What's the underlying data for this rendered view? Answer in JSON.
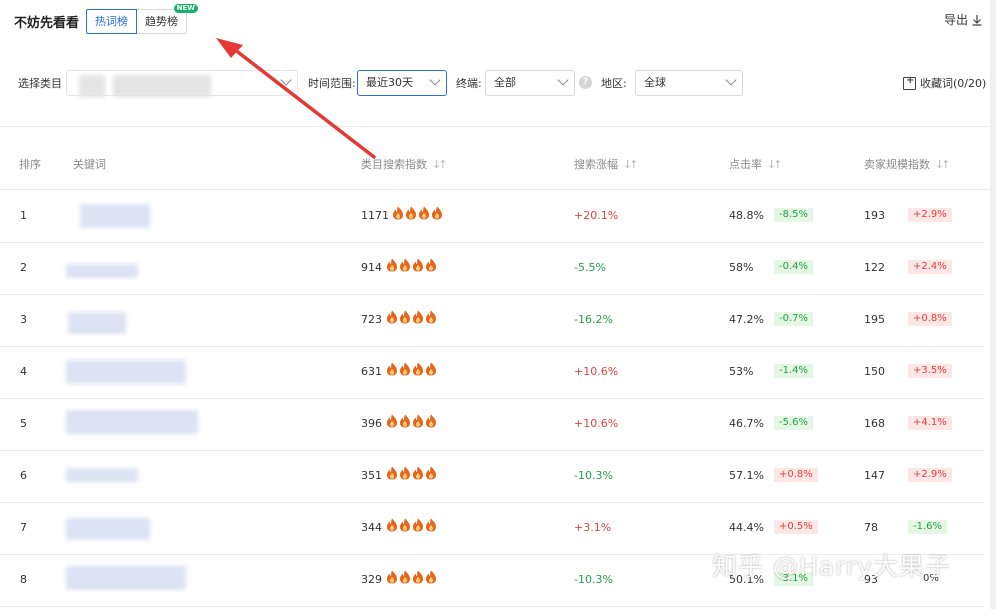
{
  "header": {
    "title": "不妨先看看",
    "tabs": [
      {
        "label": "热词榜",
        "active": true
      },
      {
        "label": "趋势榜",
        "active": false,
        "badge": "NEW"
      }
    ],
    "export_label": "导出"
  },
  "filters": {
    "category_label": "选择类目",
    "time_label": "时间范围:",
    "time_value": "最近30天",
    "channel_label": "终端:",
    "channel_value": "全部",
    "region_label": "地区:",
    "region_value": "全球",
    "collect_label": "收藏词(0/20)"
  },
  "table": {
    "columns": [
      "排序",
      "关键词",
      "类目搜索指数",
      "搜索涨幅",
      "点击率",
      "卖家规模指数"
    ],
    "rows": [
      {
        "rank": "1",
        "search_index": "1171",
        "growth": "+20.1%",
        "growth_dir": "up",
        "ctr": "48.8%",
        "ctr_change": "-8.5%",
        "ctr_dir": "down",
        "seller_index": "193",
        "seller_change": "+2.9%",
        "seller_dir": "up"
      },
      {
        "rank": "2",
        "search_index": "914",
        "growth": "-5.5%",
        "growth_dir": "down",
        "ctr": "58%",
        "ctr_change": "-0.4%",
        "ctr_dir": "down",
        "seller_index": "122",
        "seller_change": "+2.4%",
        "seller_dir": "up"
      },
      {
        "rank": "3",
        "search_index": "723",
        "growth": "-16.2%",
        "growth_dir": "down",
        "ctr": "47.2%",
        "ctr_change": "-0.7%",
        "ctr_dir": "down",
        "seller_index": "195",
        "seller_change": "+0.8%",
        "seller_dir": "up"
      },
      {
        "rank": "4",
        "search_index": "631",
        "growth": "+10.6%",
        "growth_dir": "up",
        "ctr": "53%",
        "ctr_change": "-1.4%",
        "ctr_dir": "down",
        "seller_index": "150",
        "seller_change": "+3.5%",
        "seller_dir": "up"
      },
      {
        "rank": "5",
        "search_index": "396",
        "growth": "+10.6%",
        "growth_dir": "up",
        "ctr": "46.7%",
        "ctr_change": "-5.6%",
        "ctr_dir": "down",
        "seller_index": "168",
        "seller_change": "+4.1%",
        "seller_dir": "up"
      },
      {
        "rank": "6",
        "search_index": "351",
        "growth": "-10.3%",
        "growth_dir": "down",
        "ctr": "57.1%",
        "ctr_change": "+0.8%",
        "ctr_dir": "up",
        "seller_index": "147",
        "seller_change": "+2.9%",
        "seller_dir": "up"
      },
      {
        "rank": "7",
        "search_index": "344",
        "growth": "+3.1%",
        "growth_dir": "up",
        "ctr": "44.4%",
        "ctr_change": "+0.5%",
        "ctr_dir": "up",
        "seller_index": "78",
        "seller_change": "-1.6%",
        "seller_dir": "down"
      },
      {
        "rank": "8",
        "search_index": "329",
        "growth": "-10.3%",
        "growth_dir": "down",
        "ctr": "50.1%",
        "ctr_change": "-3.1%",
        "ctr_dir": "down",
        "seller_index": "93",
        "seller_change": "0%",
        "seller_dir": "flat"
      }
    ]
  },
  "icons": {
    "flame": "flame-icon",
    "sort": "sort-icon",
    "help": "help-icon",
    "export": "download-icon",
    "collect": "collect-icon"
  },
  "colors": {
    "accent": "#2c6fdc",
    "positive": "#e0443e",
    "negative": "#25a146",
    "flame": "#e8641b",
    "annotation_arrow": "#e53935"
  },
  "watermark": "知乎 @Harry大果子"
}
